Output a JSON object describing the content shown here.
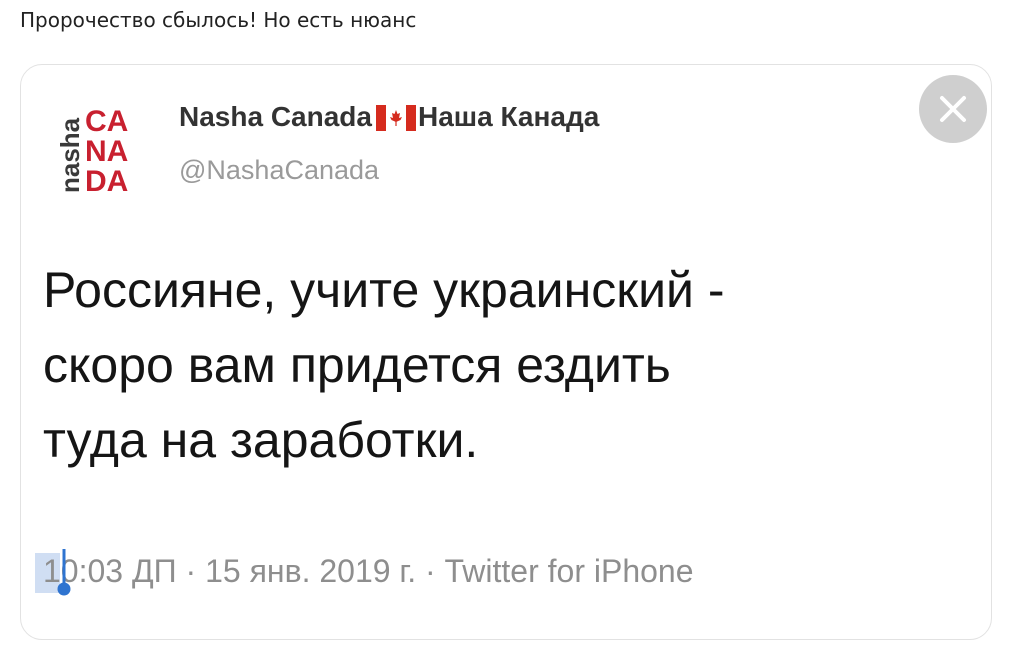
{
  "post": {
    "caption": "Пророчество сбылось! Но есть нюанс"
  },
  "tweet": {
    "author_name_left": "Nasha Canada",
    "author_name_right": "Наша Канада",
    "author_handle": "@NashaCanada",
    "text_lines": [
      "Россияне, учите украинский -",
      "скоро вам придется ездить",
      "туда на заработки."
    ],
    "meta": "10:03 ДП · 15 янв. 2019 г. · Twitter for iPhone"
  },
  "logo": {
    "vertical_text": "nasha",
    "rows": [
      "CA",
      "NA",
      "DA"
    ],
    "accent_color": "#c8202f",
    "dark_color": "#3a3a3a"
  },
  "icons": {
    "close": "close-icon",
    "flag": "canada-flag-icon"
  },
  "colors": {
    "selection": "#2f74d0",
    "meta": "#8e8e8e",
    "handle": "#9a9a9a"
  }
}
